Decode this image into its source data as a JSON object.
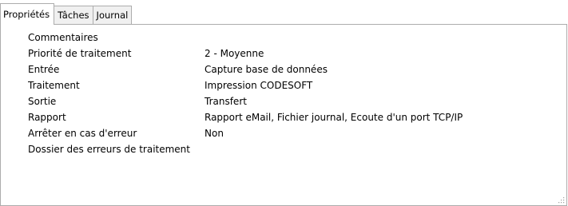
{
  "tabs": [
    {
      "label": "Propriétés",
      "active": true
    },
    {
      "label": "Tâches",
      "active": false
    },
    {
      "label": "Journal",
      "active": false
    }
  ],
  "properties": [
    {
      "label": "Commentaires",
      "value": ""
    },
    {
      "label": "Priorité de traitement",
      "value": "2 - Moyenne"
    },
    {
      "label": "Entrée",
      "value": "Capture base de données"
    },
    {
      "label": "Traitement",
      "value": "Impression CODESOFT"
    },
    {
      "label": "Sortie",
      "value": "Transfert"
    },
    {
      "label": "Rapport",
      "value": "Rapport eMail, Fichier journal, Ecoute d'un port TCP/IP"
    },
    {
      "label": "Arrêter en cas d'erreur",
      "value": "Non"
    },
    {
      "label": "Dossier des erreurs de traitement",
      "value": ""
    }
  ],
  "colors": {
    "border": "#acacac",
    "tab_inactive_bg": "#f0f0f0",
    "background": "#ffffff"
  },
  "icons": {
    "resize_grip": "resize-grip-icon"
  }
}
